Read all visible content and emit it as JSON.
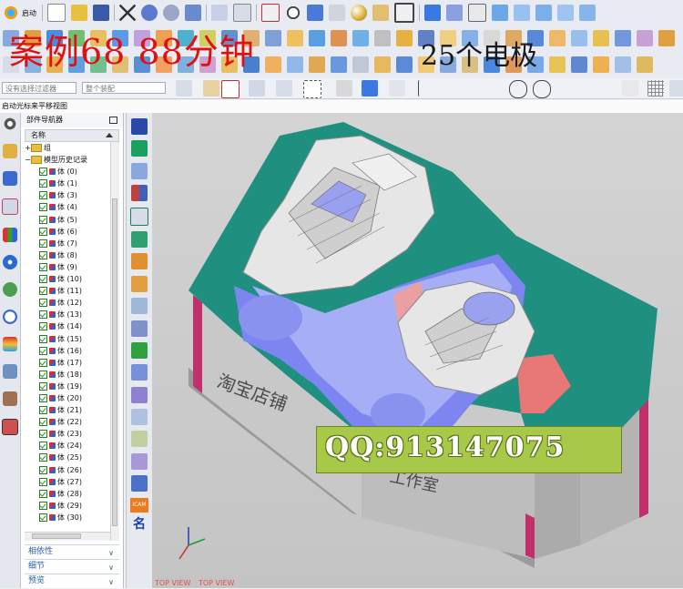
{
  "toolbar": {
    "start_label": "启动",
    "filter_placeholder": "没有选择过滤器",
    "assembly_placeholder": "整个装配",
    "status": "启动光标来平移视图"
  },
  "overlay": {
    "title_red": "案例68  88分钟",
    "title_black": "25个电极",
    "qq": "QQ:913147075"
  },
  "navigator": {
    "title": "部件导航器",
    "column_name": "名称",
    "group_label": "组",
    "history_label": "模型历史记录",
    "bodies": [
      "体 (0)",
      "体 (1)",
      "体 (3)",
      "体 (4)",
      "体 (5)",
      "体 (6)",
      "体 (7)",
      "体 (8)",
      "体 (9)",
      "体 (10)",
      "体 (11)",
      "体 (12)",
      "体 (13)",
      "体 (14)",
      "体 (15)",
      "体 (16)",
      "体 (17)",
      "体 (18)",
      "体 (19)",
      "体 (20)",
      "体 (21)",
      "体 (22)",
      "体 (23)",
      "体 (24)",
      "体 (25)",
      "体 (26)",
      "体 (27)",
      "体 (28)",
      "体 (29)",
      "体 (30)"
    ],
    "panels": [
      "相依性",
      "细节",
      "预览"
    ]
  },
  "viewport": {
    "view_labels": [
      "TOP VIEW",
      "TOP VIEW"
    ],
    "engraving_left": "淘宝店铺",
    "engraving_right": "工作室"
  },
  "resource_bar": {
    "icam_label": "iCAM",
    "name_label": "名"
  },
  "colors": {
    "title_red": "#e01010",
    "mold_teal": "#1f8f80",
    "mold_gray": "#bdbdbd",
    "cavity_blue": "#7d86f0",
    "cavity_red": "#e87878",
    "accent_magenta": "#c0306a",
    "watermark_green": "#a8c84a"
  }
}
